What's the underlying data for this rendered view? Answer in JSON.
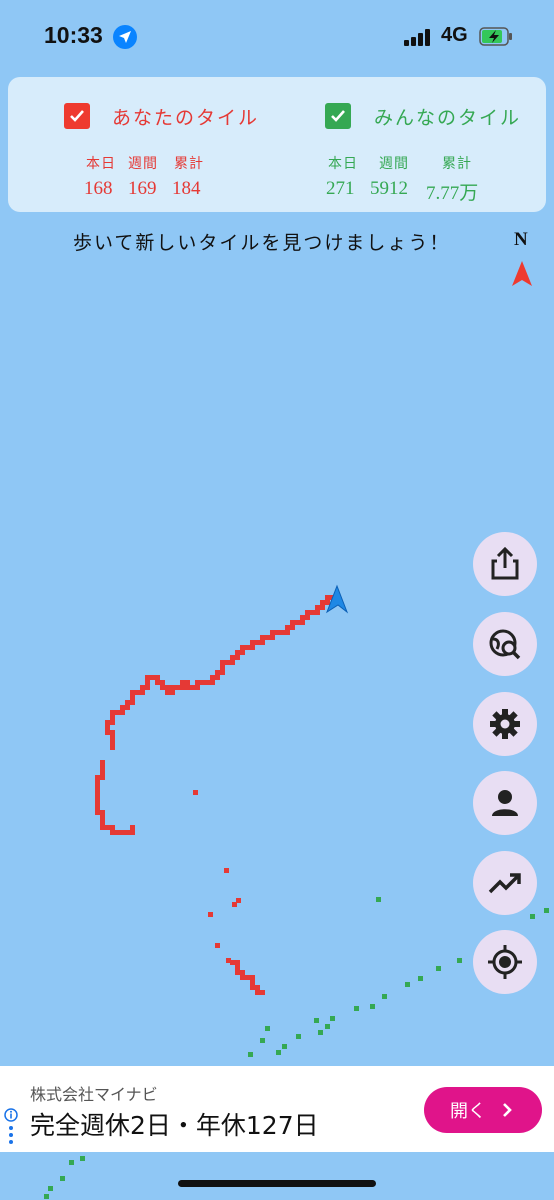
{
  "status": {
    "time": "10:33",
    "network": "4G"
  },
  "legend": {
    "mine": {
      "title": "あなたのタイル",
      "head_today": "本日",
      "head_week": "週間",
      "head_total": "累計",
      "today": "168",
      "week": "169",
      "total": "184",
      "color": "#e53935"
    },
    "everyone": {
      "title": "みんなのタイル",
      "head_today": "本日",
      "head_week": "週間",
      "head_total": "累計",
      "today": "271",
      "week": "5912",
      "total": "7.77万",
      "color": "#35a853"
    }
  },
  "hint": "歩いて新しいタイルを見つけましょう！",
  "compass": {
    "label": "N"
  },
  "fab_icons": [
    "share-icon",
    "globe-search-icon",
    "gear-icon",
    "person-icon",
    "trending-icon",
    "locate-icon"
  ],
  "ad": {
    "company": "株式会社マイナビ",
    "headline": "完全週休2日・年休127日",
    "button": "開く"
  },
  "colors": {
    "map": "#8fc7f5",
    "my_tile": "#e53935",
    "others_tile": "#35a853",
    "ad_button": "#e0148a"
  }
}
